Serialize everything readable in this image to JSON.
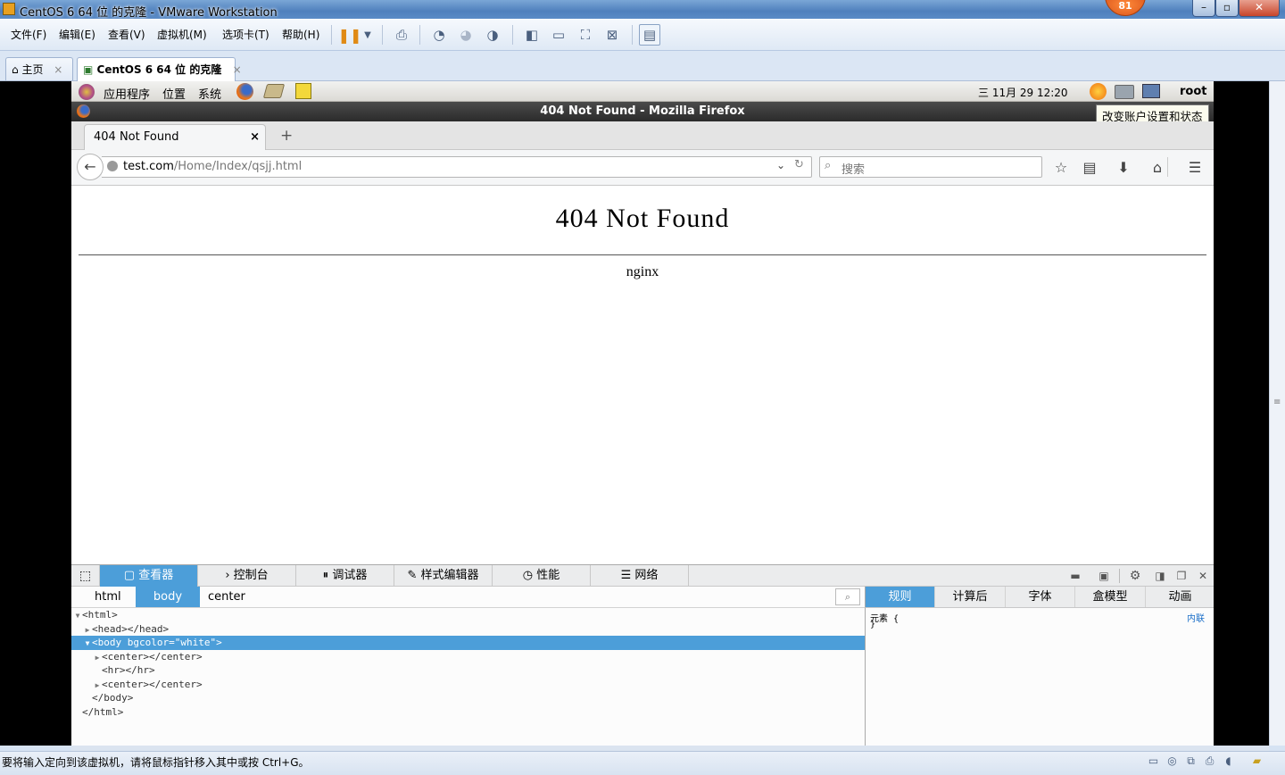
{
  "vmware": {
    "title": "CentOS 6 64 位 的克隆 - VMware Workstation",
    "badge": "81",
    "window_buttons": [
      "–",
      "▫",
      "✕"
    ],
    "menus": [
      "文件(F)",
      "编辑(E)",
      "查看(V)",
      "虚拟机(M)",
      "选项卡(T)",
      "帮助(H)"
    ],
    "tabs": [
      {
        "label": "主页",
        "close": "×"
      },
      {
        "label": "CentOS 6 64 位 的克隆",
        "close": "×"
      }
    ],
    "status_message": "要将输入定向到该虚拟机，请将鼠标指针移入其中或按 Ctrl+G。"
  },
  "gnome": {
    "menus": [
      "应用程序",
      "位置",
      "系统"
    ],
    "clock": "三 11月 29 12:20",
    "user": "root",
    "tooltip": "改变账户设置和状态"
  },
  "firefox": {
    "window_title": "404 Not Found - Mozilla Firefox",
    "tab_title": "404 Not Found",
    "tab_close": "×",
    "new_tab": "+",
    "url_host": "test.com",
    "url_path": "/Home/Index/qsjj.html",
    "search_placeholder": "搜索"
  },
  "page": {
    "heading": "404 Not Found",
    "server": "nginx"
  },
  "devtools": {
    "tabs": [
      "查看器",
      "控制台",
      "调试器",
      "样式编辑器",
      "性能",
      "网络"
    ],
    "tab_icons": [
      "▢",
      "›",
      "⏸",
      "✎",
      "◷",
      "☰"
    ],
    "breadcrumbs": [
      "html",
      "body",
      "center"
    ],
    "markup": [
      {
        "twisty": "▼",
        "text": "<html>",
        "indent": 0,
        "selected": false
      },
      {
        "twisty": "▶",
        "text": "<head></head>",
        "indent": 1,
        "selected": false
      },
      {
        "twisty": "▼",
        "text": "<body bgcolor=\"white\">",
        "indent": 1,
        "selected": true
      },
      {
        "twisty": "▶",
        "text": "<center></center>",
        "indent": 2,
        "selected": false
      },
      {
        "twisty": "",
        "text": "<hr></hr>",
        "indent": 2,
        "selected": false
      },
      {
        "twisty": "▶",
        "text": "<center></center>",
        "indent": 2,
        "selected": false
      },
      {
        "twisty": "",
        "text": "</body>",
        "indent": 1,
        "selected": false
      },
      {
        "twisty": "",
        "text": "</html>",
        "indent": 0,
        "selected": false
      }
    ],
    "side_tabs": [
      "规则",
      "计算后",
      "字体",
      "盒模型",
      "动画"
    ],
    "rules": {
      "selector_line": "元素 {",
      "close_line": "}",
      "source": "内联"
    }
  },
  "colors": {
    "devtools_accent": "#4c9ed9",
    "vmware_title": "#4f80bd"
  }
}
